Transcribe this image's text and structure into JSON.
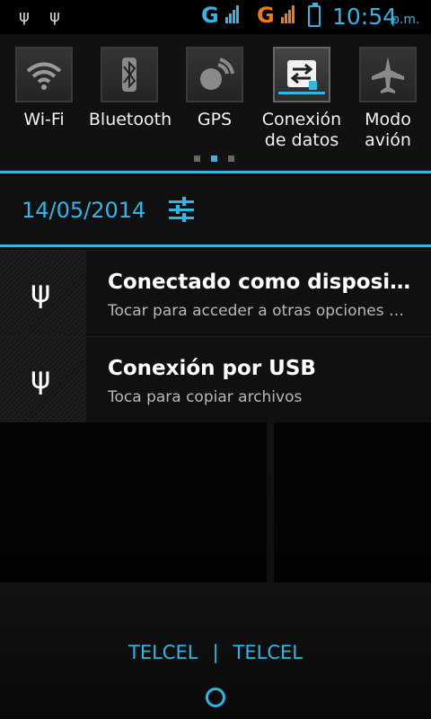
{
  "status_bar": {
    "network_1": "G",
    "network_2": "G",
    "time": "10:54",
    "ampm": "p.m.",
    "colors": {
      "accent": "#33b5e5",
      "orange": "#f07a1a"
    },
    "icons": [
      "usb-icon",
      "usb-icon",
      "signal-icon",
      "signal-icon",
      "battery-charging-icon"
    ]
  },
  "quick_settings": {
    "tiles": [
      {
        "label": "Wi-Fi",
        "icon": "wifi-icon"
      },
      {
        "label": "Bluetooth",
        "icon": "bluetooth-icon"
      },
      {
        "label": "GPS",
        "icon": "gps-icon"
      },
      {
        "label": "Conexión\nde datos",
        "icon": "data-connection-icon"
      },
      {
        "label": "Modo\navión",
        "icon": "airplane-mode-icon"
      }
    ],
    "page_indicator": {
      "count": 3,
      "active": 1
    }
  },
  "header": {
    "date": "14/05/2014",
    "settings_icon": "settings-sliders-icon"
  },
  "notifications": [
    {
      "title": "Conectado como dispositivo multimedia",
      "subtitle": "Tocar para acceder a otras opciones de USB.",
      "icon": "usb-icon"
    },
    {
      "title": "Conexión por USB",
      "subtitle": "Toca para copiar archivos",
      "icon": "usb-icon"
    }
  ],
  "footer": {
    "carrier_1": "TELCEL",
    "separator": "|",
    "carrier_2": "TELCEL",
    "handle_icon": "drag-handle-icon"
  }
}
